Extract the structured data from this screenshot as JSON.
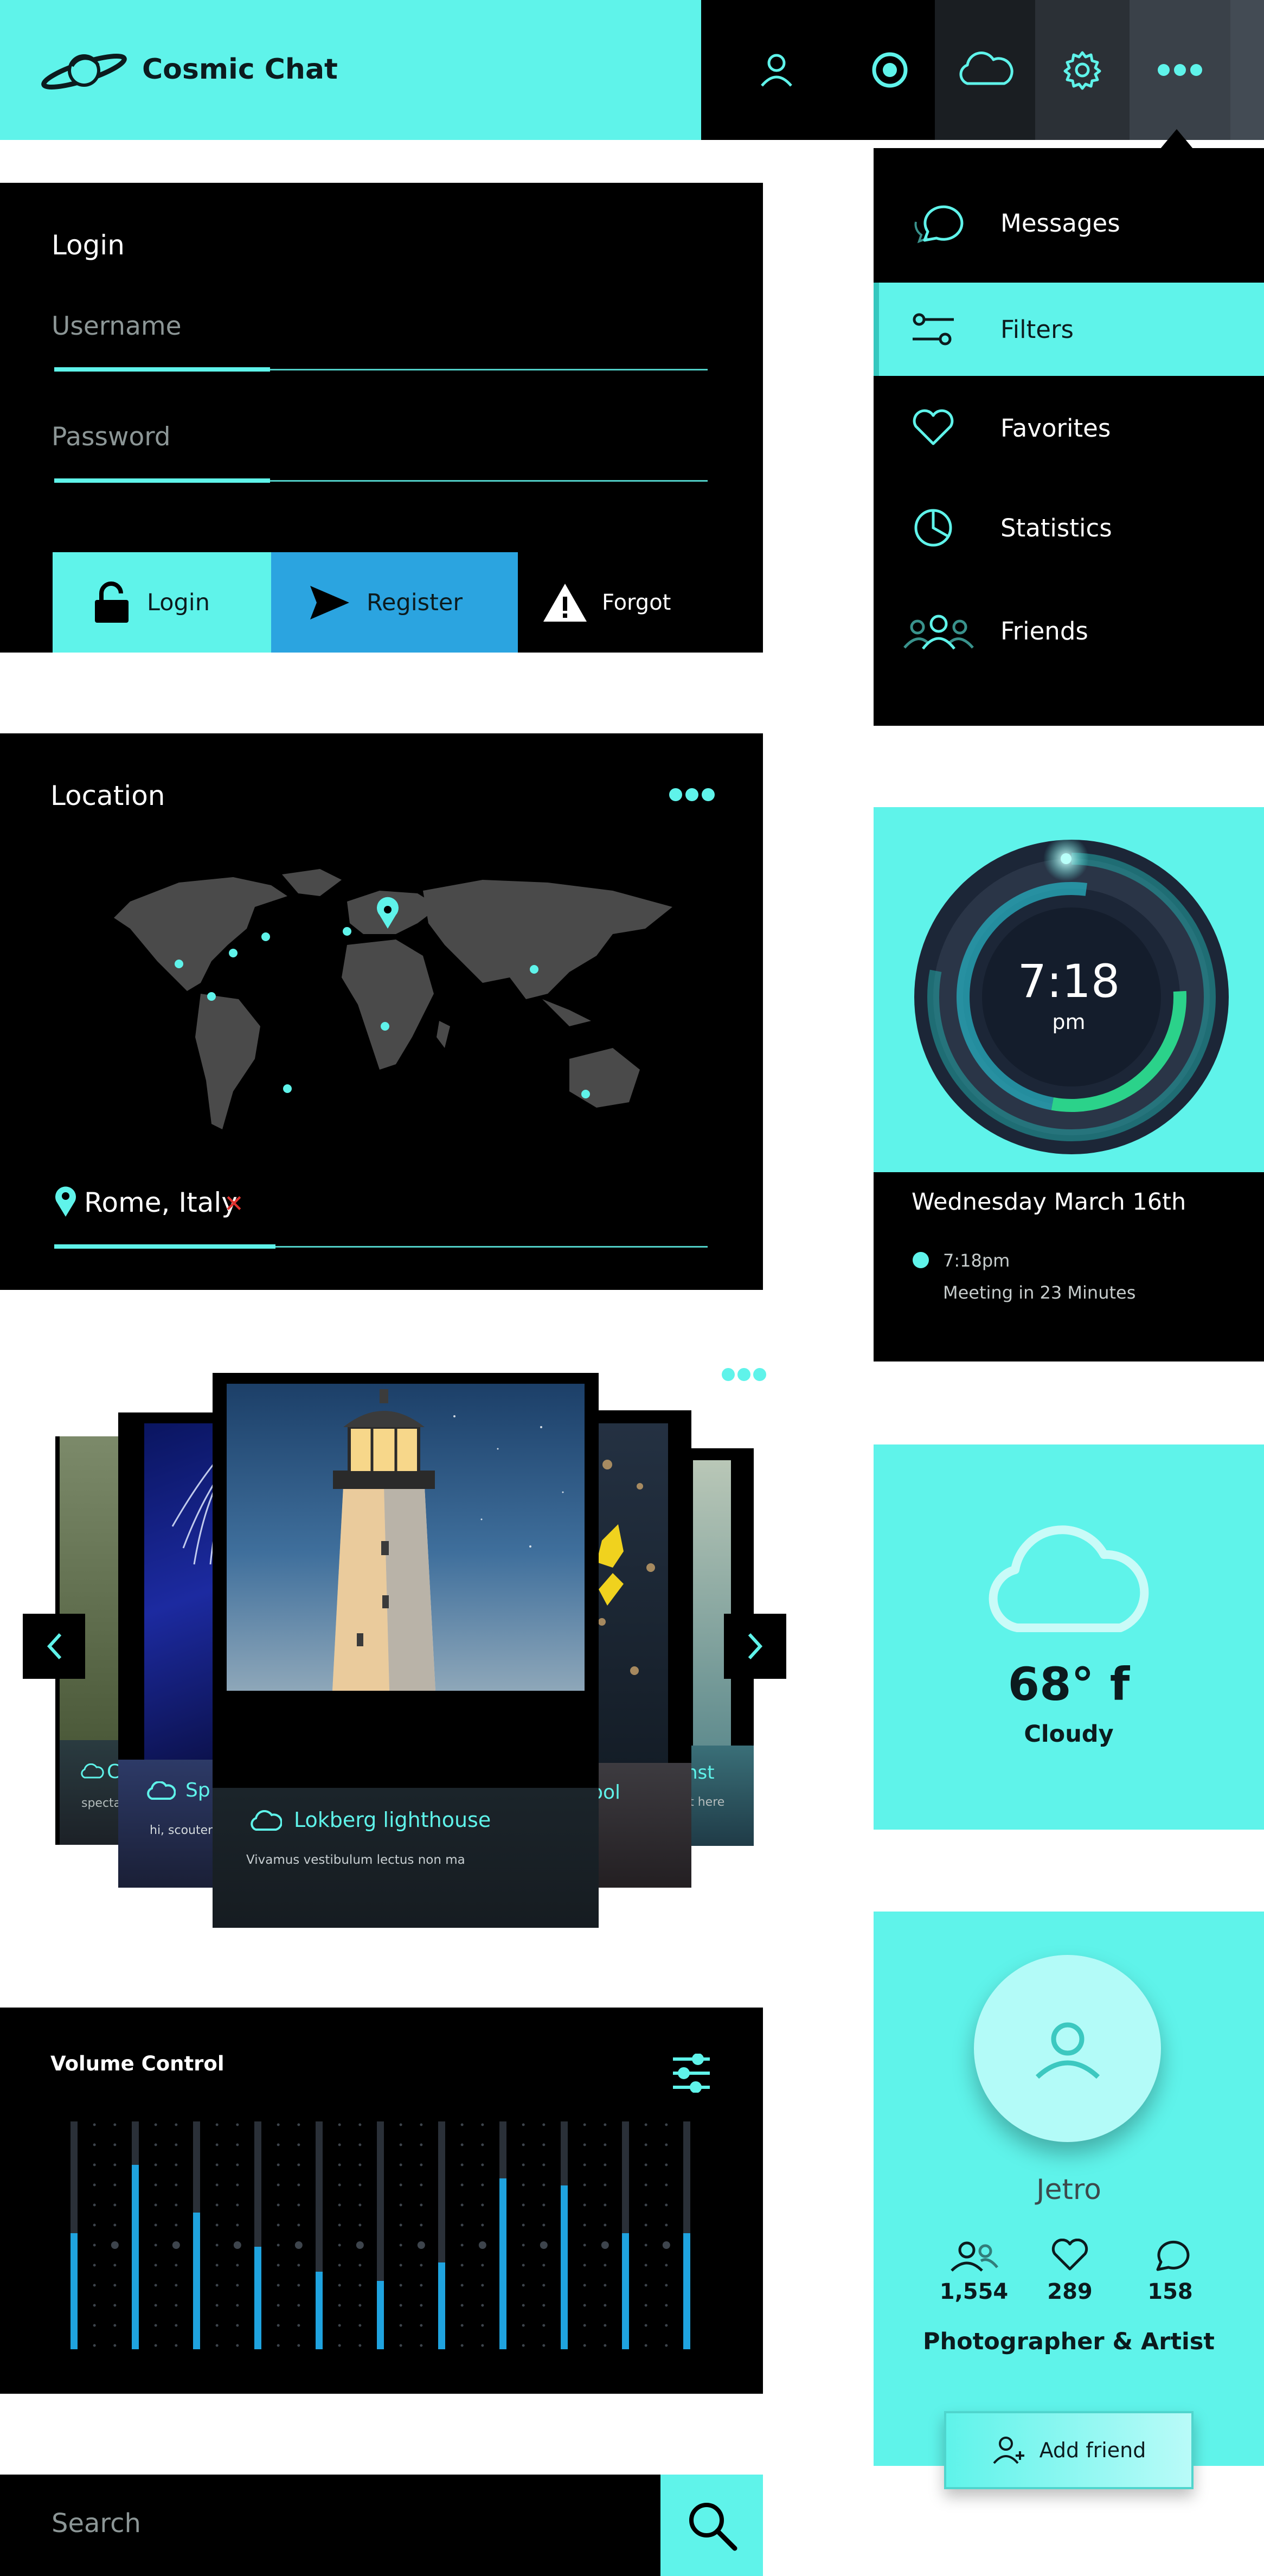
{
  "app": {
    "title": "Cosmic Chat"
  },
  "header": {
    "icons": [
      "user-icon",
      "target-icon",
      "cloud-icon",
      "gear-icon",
      "more-icon"
    ]
  },
  "login": {
    "title": "Login",
    "username_placeholder": "Username",
    "password_placeholder": "Password",
    "login_label": "Login",
    "register_label": "Register",
    "forgot_label": "Forgot"
  },
  "menu": {
    "items": [
      {
        "label": "Messages",
        "icon": "chat-bubble-icon"
      },
      {
        "label": "Filters",
        "icon": "filters-icon",
        "active": true
      },
      {
        "label": "Favorites",
        "icon": "heart-icon"
      },
      {
        "label": "Statistics",
        "icon": "pie-chart-icon"
      },
      {
        "label": "Friends",
        "icon": "friends-icon"
      }
    ]
  },
  "location": {
    "title": "Location",
    "place": "Rome, Italy"
  },
  "clock": {
    "time": "7:18",
    "meridiem": "pm",
    "date": "Wednesday March 16th",
    "event_time": "7:18pm",
    "event_text": "Meeting in 23 Minutes"
  },
  "weather": {
    "temperature": "68° f",
    "condition": "Cloudy"
  },
  "carousel": {
    "main": {
      "title": "Lokberg lighthouse",
      "text": "Vivamus vestibulum lectus non ma"
    },
    "left1": {
      "title": "Sp",
      "text": "hi, scoutere"
    },
    "left2": {
      "title": "C",
      "text": "spectac"
    },
    "right1": {
      "title": "ool",
      "text": ""
    },
    "right2": {
      "title": "nst",
      "text": "it here"
    }
  },
  "volume": {
    "title": "Volume Control",
    "levels": [
      0.51,
      0.81,
      0.6,
      0.45,
      0.34,
      0.3,
      0.38,
      0.75,
      0.72,
      0.51,
      0.51
    ]
  },
  "profile": {
    "name": "Jetro",
    "followers": "1,554",
    "likes": "289",
    "comments": "158",
    "role": "Photographer & Artist",
    "add_friend_label": "Add friend"
  },
  "search": {
    "placeholder": "Search"
  },
  "colors": {
    "accent": "#5ff3ea",
    "blue": "#2ba4e0",
    "dark": "#000000"
  }
}
